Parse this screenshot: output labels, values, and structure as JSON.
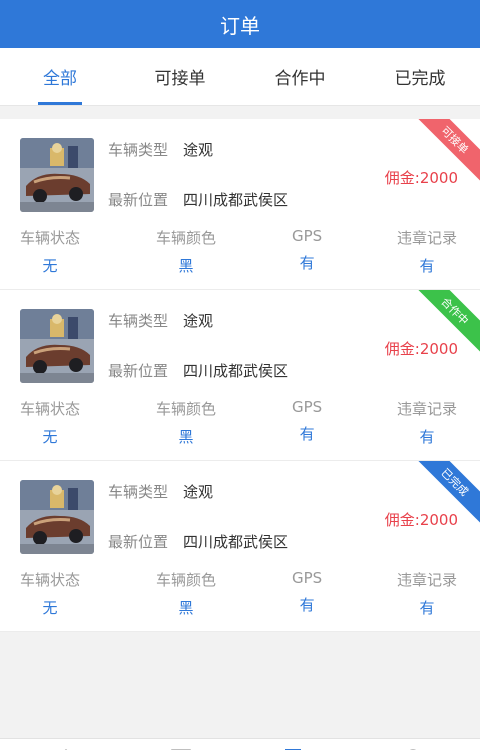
{
  "header": {
    "title": "订单"
  },
  "tabs": [
    {
      "label": "全部",
      "active": true
    },
    {
      "label": "可接单",
      "active": false
    },
    {
      "label": "合作中",
      "active": false
    },
    {
      "label": "已完成",
      "active": false
    }
  ],
  "orders": [
    {
      "type_label": "车辆类型",
      "type_value": "途观",
      "location_label": "最新位置",
      "location_value": "四川成都武侯区",
      "commission": "佣金:2000",
      "ribbon": "可接单",
      "ribbon_color": "#f0646c",
      "stats": [
        {
          "label": "车辆状态",
          "value": "无"
        },
        {
          "label": "车辆颜色",
          "value": "黑"
        },
        {
          "label": "GPS",
          "value": "有"
        },
        {
          "label": "违章记录",
          "value": "有"
        }
      ]
    },
    {
      "type_label": "车辆类型",
      "type_value": "途观",
      "location_label": "最新位置",
      "location_value": "四川成都武侯区",
      "commission": "佣金:2000",
      "ribbon": "合作中",
      "ribbon_color": "#3cc24a",
      "stats": [
        {
          "label": "车辆状态",
          "value": "无"
        },
        {
          "label": "车辆颜色",
          "value": "黑"
        },
        {
          "label": "GPS",
          "value": "有"
        },
        {
          "label": "违章记录",
          "value": "有"
        }
      ]
    },
    {
      "type_label": "车辆类型",
      "type_value": "途观",
      "location_label": "最新位置",
      "location_value": "四川成都武侯区",
      "commission": "佣金:2000",
      "ribbon": "已完成",
      "ribbon_color": "#2f78d8",
      "stats": [
        {
          "label": "车辆状态",
          "value": "无"
        },
        {
          "label": "车辆颜色",
          "value": "黑"
        },
        {
          "label": "GPS",
          "value": "有"
        },
        {
          "label": "违章记录",
          "value": "有"
        }
      ]
    }
  ],
  "bottom_nav": [
    {
      "icon": "home-icon"
    },
    {
      "icon": "square-icon"
    },
    {
      "icon": "orders-icon"
    },
    {
      "icon": "user-icon"
    }
  ],
  "colors": {
    "primary": "#2f78d8",
    "commission": "#e8414b"
  }
}
